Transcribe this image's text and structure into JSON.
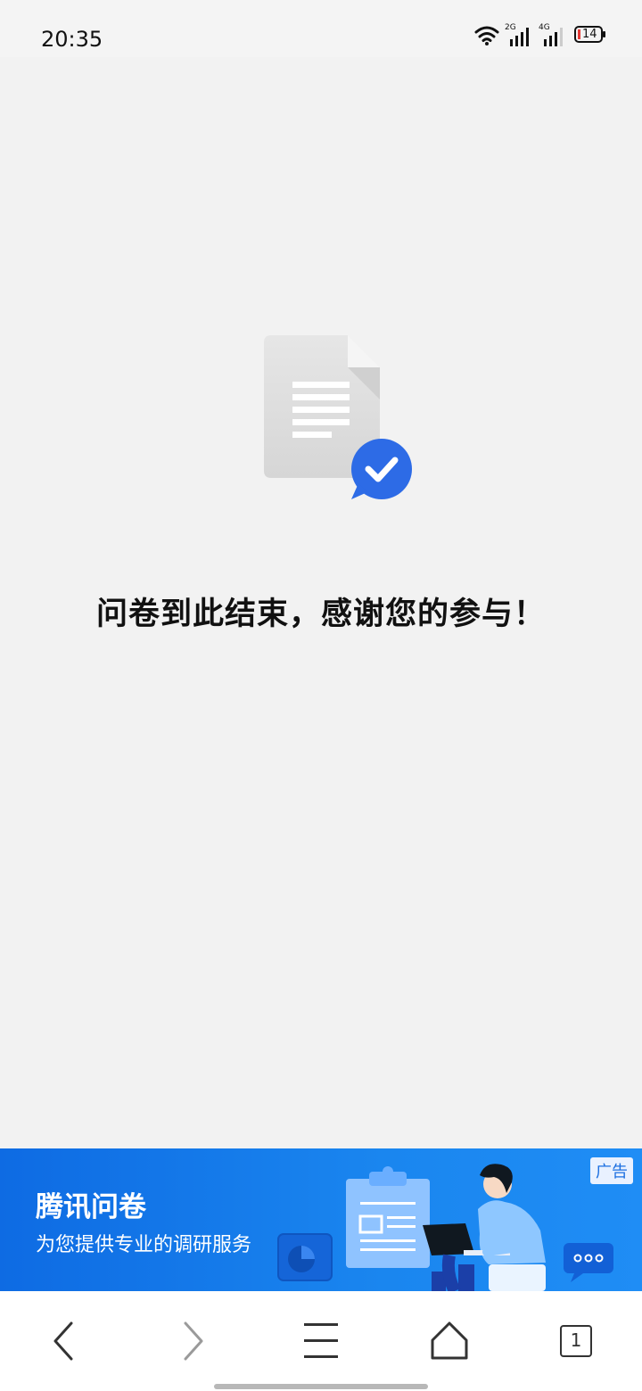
{
  "status_bar": {
    "time": "20:35",
    "network_1": "2G",
    "network_2": "4G",
    "battery_level": "14",
    "icons": [
      "wifi-icon",
      "signal-2g-icon",
      "signal-4g-icon",
      "battery-icon"
    ]
  },
  "main": {
    "end_message": "问卷到此结束，感谢您的参与！",
    "illustration_icons": [
      "document-icon",
      "check-badge-icon"
    ]
  },
  "ad": {
    "title": "腾讯问卷",
    "subtitle": "为您提供专业的调研服务",
    "badge": "广告"
  },
  "bottom_nav": {
    "buttons": [
      "back-icon",
      "forward-icon",
      "menu-icon",
      "home-icon",
      "tabs-icon"
    ],
    "tab_count": "1"
  },
  "colors": {
    "accent": "#2d6be6",
    "background": "#f2f2f2",
    "ad_background": "#1a86ef"
  }
}
